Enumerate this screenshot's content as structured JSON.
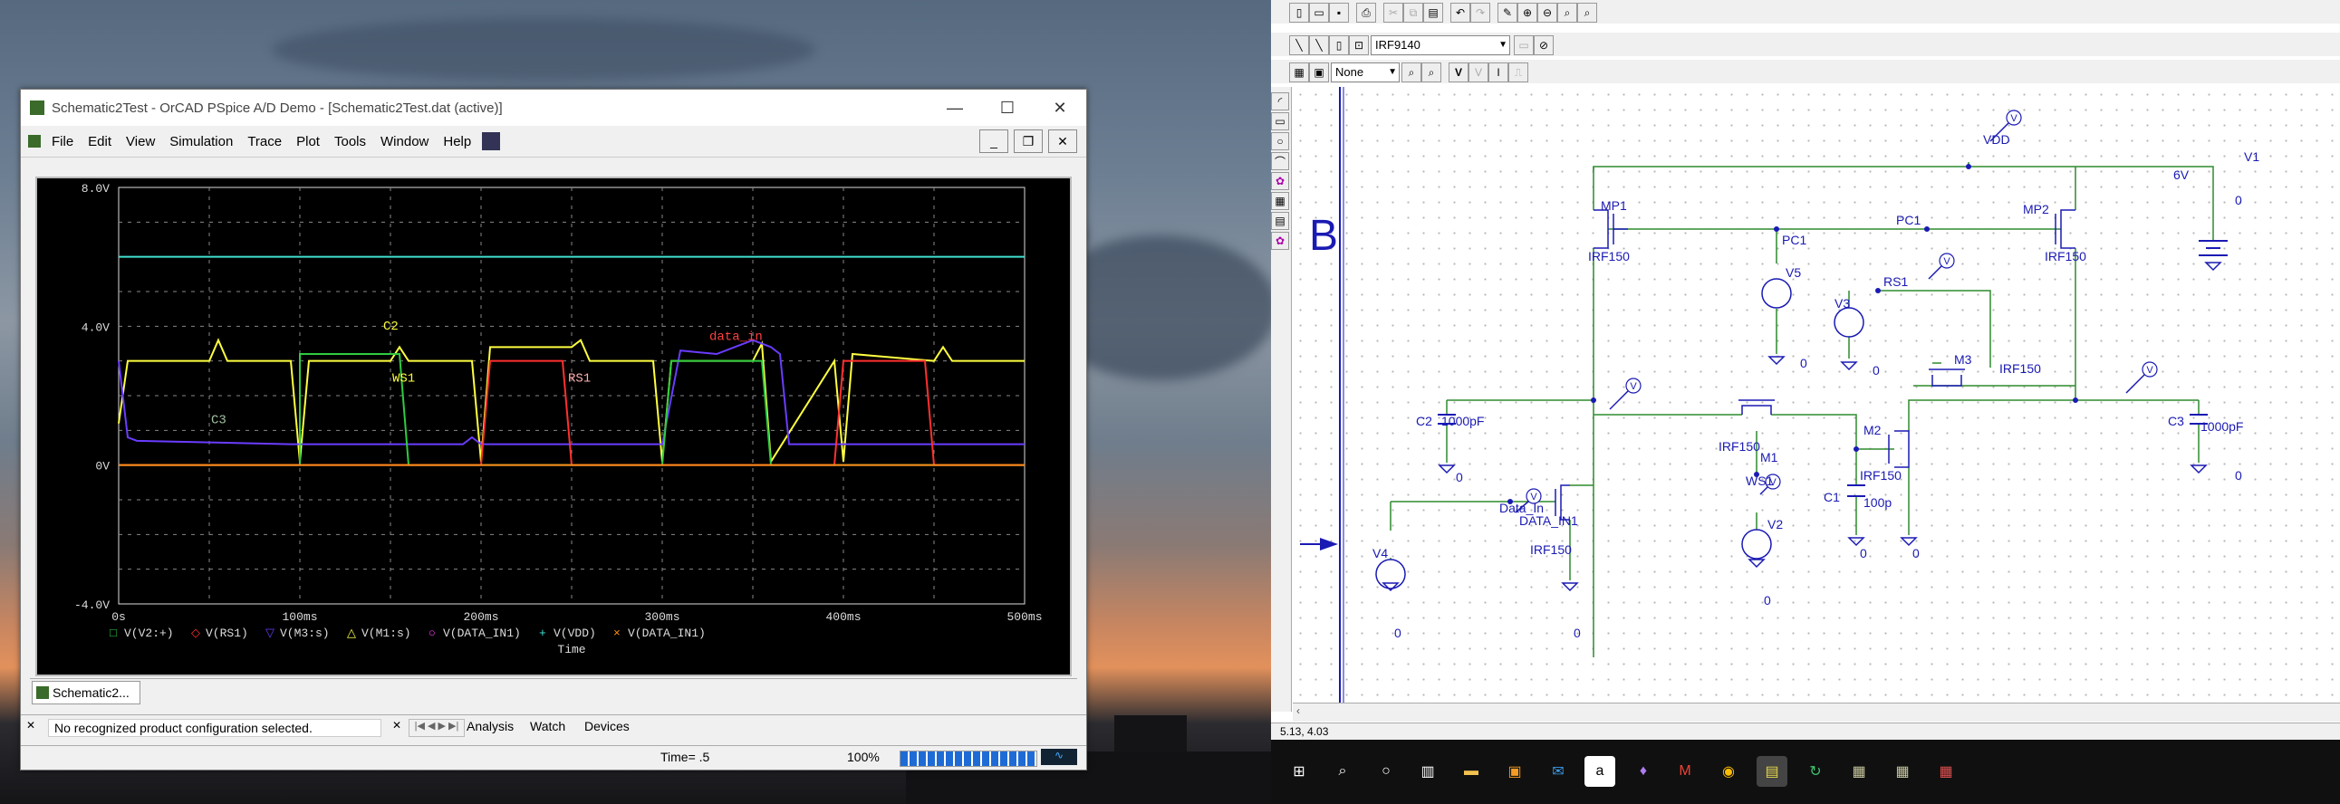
{
  "pspice": {
    "title": "Schematic2Test - OrCAD PSpice A/D Demo - [Schematic2Test.dat (active)]",
    "menu": [
      "File",
      "Edit",
      "View",
      "Simulation",
      "Trace",
      "Plot",
      "Tools",
      "Window",
      "Help"
    ],
    "window_controls": [
      "—",
      "☐",
      "✕"
    ],
    "tab_label": "Schematic2...",
    "status_message": "No recognized product configuration selected.",
    "sheet_tabs": [
      "Analysis",
      "Watch",
      "Devices"
    ],
    "time_readout": "Time= .5",
    "zoom": "100%",
    "progress": 1.0
  },
  "chart_data": {
    "type": "line",
    "xlabel": "Time",
    "ylabel": "",
    "xlim": [
      0,
      500
    ],
    "ylim": [
      -4,
      8
    ],
    "x_ticks": [
      "0s",
      "100ms",
      "200ms",
      "300ms",
      "400ms",
      "500ms"
    ],
    "y_ticks": [
      "8.0V",
      "4.0V",
      "0V",
      "-4.0V"
    ],
    "grid": true,
    "legend": [
      {
        "marker": "□",
        "name": "V(V2:+)",
        "color": "#2ecc40"
      },
      {
        "marker": "◇",
        "name": "V(RS1)",
        "color": "#ff3030"
      },
      {
        "marker": "▽",
        "name": "V(M3:s)",
        "color": "#6a3cff"
      },
      {
        "marker": "△",
        "name": "V(M1:s)",
        "color": "#ffff40"
      },
      {
        "marker": "○",
        "name": "V(DATA_IN1)",
        "color": "#ff40ff"
      },
      {
        "marker": "+",
        "name": "V(VDD)",
        "color": "#40e0d0"
      },
      {
        "marker": "×",
        "name": "V(DATA_IN1)",
        "color": "#ff8c1a"
      }
    ],
    "annotations": [
      "C2",
      "C3",
      "WS1",
      "RS1",
      "data_in"
    ],
    "series": [
      {
        "name": "V(VDD)",
        "color": "#40e0d0",
        "x": [
          0,
          500
        ],
        "y": [
          6,
          6
        ]
      },
      {
        "name": "V(M1:s)",
        "color": "#ffff40",
        "x": [
          0,
          5,
          10,
          50,
          55,
          60,
          95,
          100,
          105,
          150,
          155,
          160,
          195,
          200,
          205,
          250,
          255,
          260,
          295,
          300,
          305,
          350,
          355,
          360,
          395,
          400,
          405,
          450,
          455,
          460,
          500
        ],
        "y": [
          1.2,
          3.0,
          3.0,
          3.0,
          3.6,
          3.0,
          3.0,
          0.1,
          3.0,
          3.0,
          3.4,
          3.0,
          3.0,
          0.1,
          3.4,
          3.4,
          3.6,
          3.0,
          3.0,
          0.1,
          3.0,
          3.0,
          3.5,
          0.1,
          3.0,
          0.1,
          3.2,
          3.0,
          3.4,
          3.0,
          3.0
        ]
      },
      {
        "name": "V(M3:s)",
        "color": "#6a3cff",
        "x": [
          0,
          5,
          10,
          95,
          100,
          105,
          150,
          190,
          195,
          200,
          250,
          260,
          270,
          300,
          310,
          330,
          340,
          350,
          360,
          365,
          370,
          395,
          400,
          405,
          450,
          455,
          460,
          500
        ],
        "y": [
          3.0,
          0.8,
          0.7,
          0.6,
          0.6,
          0.6,
          0.6,
          0.6,
          0.8,
          0.6,
          0.6,
          0.6,
          0.6,
          0.6,
          3.3,
          3.2,
          3.4,
          3.6,
          3.4,
          3.2,
          0.6,
          0.6,
          0.6,
          0.6,
          0.6,
          0.6,
          0.6,
          0.6
        ]
      },
      {
        "name": "V(V2:+)",
        "color": "#2ecc40",
        "x": [
          0,
          95,
          100,
          100,
          150,
          155,
          160,
          200,
          205,
          300,
          305,
          355,
          360,
          500
        ],
        "y": [
          0,
          0,
          0,
          3.2,
          3.2,
          3.2,
          0,
          0,
          0,
          0,
          3.0,
          3.0,
          0,
          0
        ]
      },
      {
        "name": "V(RS1)",
        "color": "#ff3030",
        "x": [
          0,
          200,
          205,
          210,
          245,
          250,
          255,
          300,
          305,
          310,
          355,
          395,
          400,
          405,
          445,
          450,
          455,
          500
        ],
        "y": [
          0,
          0,
          3.0,
          3.0,
          3.0,
          0,
          0,
          0,
          0,
          0,
          0,
          0,
          3.0,
          3.0,
          3.0,
          0,
          0,
          0
        ]
      },
      {
        "name": "V(DATA_IN1)",
        "color": "#ff8c1a",
        "x": [
          0,
          500
        ],
        "y": [
          0,
          0
        ]
      }
    ]
  },
  "schematic": {
    "sidebar_letter": "B",
    "part_name": "IRF9140",
    "style_select": "None",
    "status_coords": "5.13, 4.03",
    "labels": {
      "vdd": "VDD",
      "v1": "V1",
      "v1_val": "6V",
      "mp1": "MP1",
      "mp2": "MP2",
      "mp1_part": "IRF150",
      "mp2_part": "IRF150",
      "pc1a": "PC1",
      "pc1b": "PC1",
      "v5": "V5",
      "v3": "V3",
      "rs1": "RS1",
      "m3": "M3",
      "m3_part": "IRF150",
      "c2": "C2",
      "c2_val": "1000pF",
      "c3": "C3",
      "c3_val": "1000pF",
      "m1": "M1",
      "m1_part": "IRF150",
      "m2": "M2",
      "m2_part": "IRF150",
      "ws1": "WS1",
      "v2": "V2",
      "c1": "C1",
      "c1_val": "100p",
      "data_in": "Data_In",
      "data_in1": "DATA_IN1",
      "v4": "V4",
      "m_part": "IRF150",
      "v_marker": "V",
      "zero": "0"
    }
  },
  "taskbar": {
    "icons": [
      "windows-icon",
      "search-icon",
      "cortana-icon",
      "task-view-icon",
      "file-explorer-icon",
      "store-icon",
      "mail-icon",
      "amazon-icon",
      "paint-icon",
      "gmail-icon",
      "chrome-icon",
      "pspice-icon",
      "sync-icon",
      "schematics-icon",
      "probe-icon",
      "capture-icon"
    ]
  }
}
